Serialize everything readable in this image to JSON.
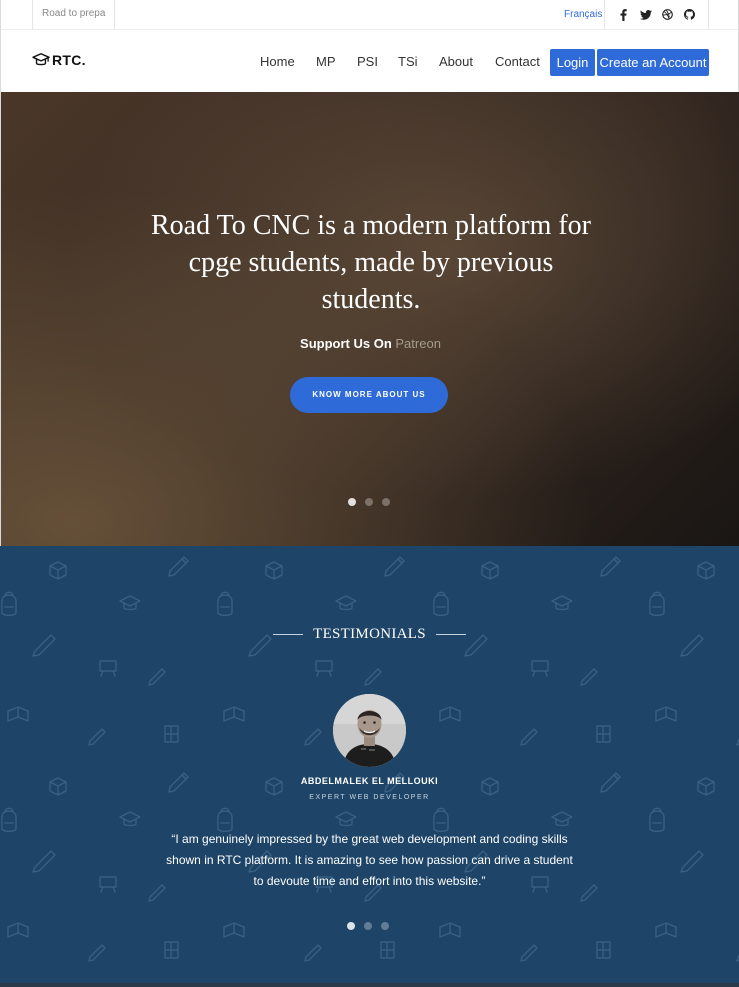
{
  "topbar": {
    "tagline": "Road to prepa",
    "language": "Français",
    "social": [
      {
        "icon": "facebook-icon",
        "glyph": "f"
      },
      {
        "icon": "twitter-icon",
        "glyph": "t"
      },
      {
        "icon": "dribbble-icon",
        "glyph": "d"
      },
      {
        "icon": "github-icon",
        "glyph": "g"
      }
    ]
  },
  "nav": {
    "brand": "RTC.",
    "links": [
      "Home",
      "MP",
      "PSI",
      "TSi",
      "About",
      "Contact"
    ],
    "login": "Login",
    "create_account": "Create an Account"
  },
  "hero": {
    "headline": "Road To CNC is a modern platform for cpge students, made by previous students.",
    "support_prefix": "Support Us On",
    "support_link": "Patreon",
    "cta": "Know more about us",
    "slides": 3,
    "active_slide": 1
  },
  "testimonials": {
    "title": "TESTIMONIALS",
    "name": "ABDELMALEK EL MELLOUKI",
    "role": "EXPERT WEB DEVELOPER",
    "quote": "“I am genuinely impressed by the great web development and coding skills shown in RTC platform. It is amazing to see how passion can drive a student to devoute time and effort into this website.”",
    "slides": 3,
    "active_slide": 1
  },
  "colors": {
    "accent": "#2f6bd8",
    "testimonial_bg": "#1e4568",
    "patreon_text": "#a59b8e"
  }
}
